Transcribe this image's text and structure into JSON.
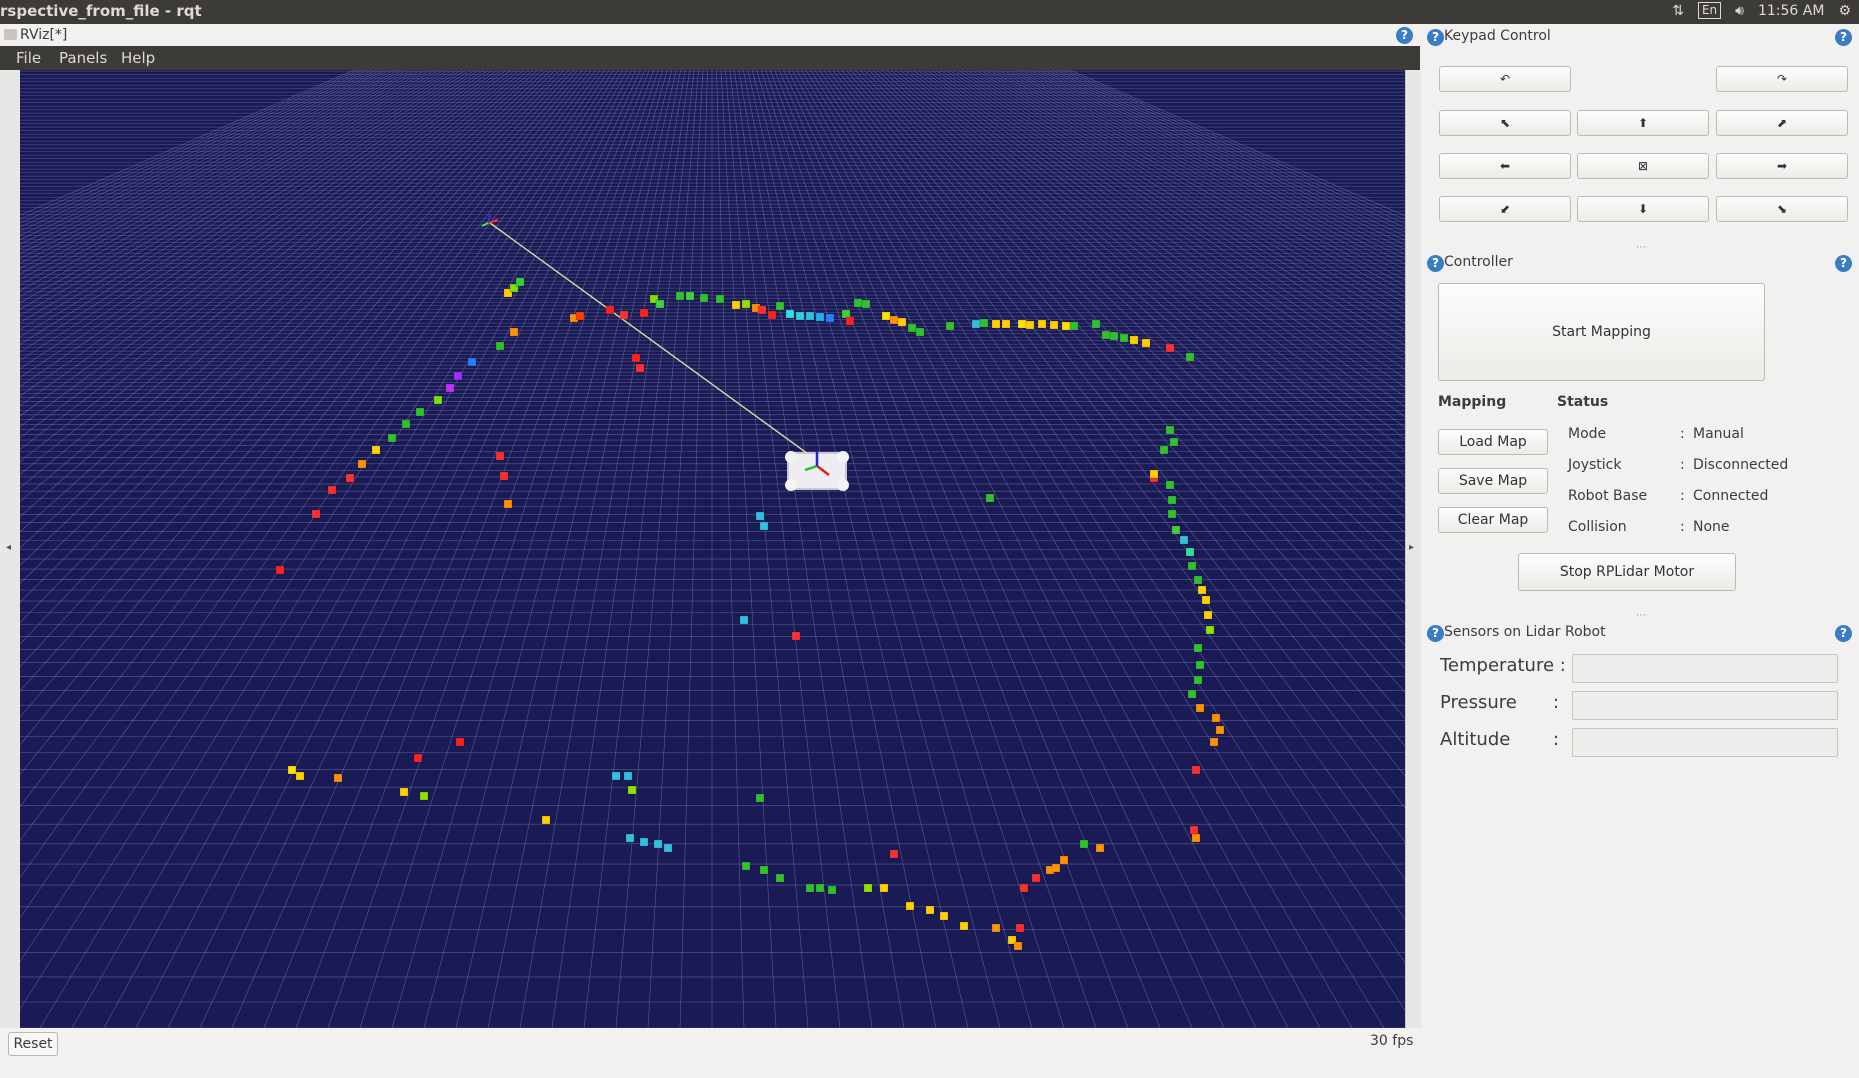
{
  "system_bar": {
    "title": "rspective_from_file - rqt",
    "lang": "En",
    "time": "11:56 AM",
    "icons": [
      "network-icon",
      "volume-icon",
      "gear-icon"
    ]
  },
  "rviz": {
    "title": "RViz[*]",
    "menu": [
      "File",
      "Panels",
      "Help"
    ],
    "reset_label": "Reset",
    "fps": "30 fps",
    "colors": {
      "background": "#1a1a55",
      "grid": "#8c90c8"
    }
  },
  "keypad": {
    "title": "Keypad Control",
    "buttons": {
      "rotate_left": "↶",
      "rotate_right": "↷",
      "up_left": "⬉",
      "up": "⬆",
      "up_right": "⬈",
      "left": "⬅",
      "stop": "⊠",
      "right": "➡",
      "down_left": "⬋",
      "down": "⬇",
      "down_right": "⬊"
    }
  },
  "controller": {
    "title": "Controller",
    "start_mapping": "Start Mapping",
    "mapping_header": "Mapping",
    "status_header": "Status",
    "load_map": "Load Map",
    "save_map": "Save Map",
    "clear_map": "Clear Map",
    "status": [
      {
        "label": "Mode",
        "sep": ":",
        "value": "Manual"
      },
      {
        "label": "Joystick",
        "sep": ":",
        "value": "Disconnected"
      },
      {
        "label": "Robot Base",
        "sep": ":",
        "value": "Connected"
      },
      {
        "label": "Collision",
        "sep": ":",
        "value": "None"
      }
    ],
    "stop_motor": "Stop RPLidar Motor"
  },
  "sensors": {
    "title": "Sensors on Lidar Robot",
    "temperature_label": "Temperature :",
    "pressure_label": "Pressure",
    "altitude_label": "Altitude",
    "colon": ":",
    "temperature_value": "",
    "pressure_value": "",
    "altitude_value": ""
  }
}
